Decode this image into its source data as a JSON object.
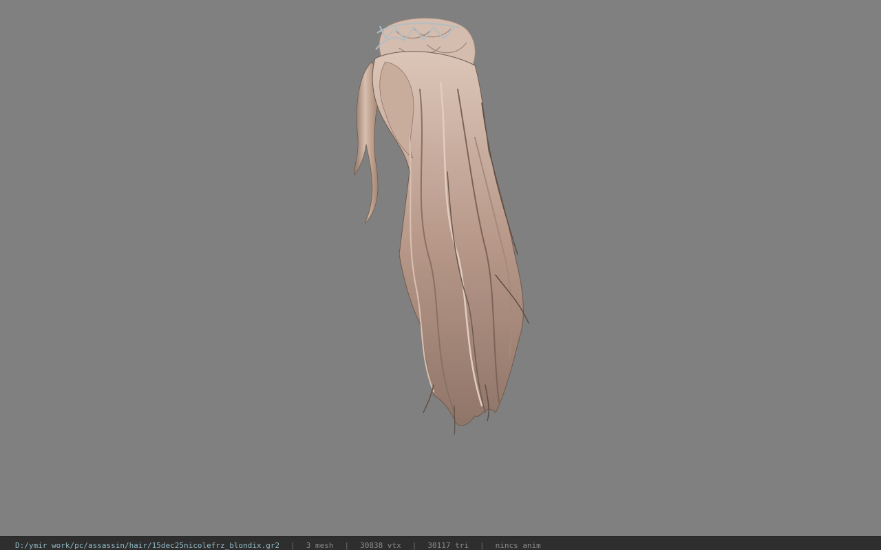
{
  "window": {
    "background": "#808080"
  },
  "viewport": {
    "model": {
      "description_icon": "hair-mesh-render",
      "colors": {
        "hair_light": "#d9bfae",
        "hair_mid": "#b79a88",
        "hair_dark": "#6d5a4e",
        "tiara": "#a9b4b8"
      }
    }
  },
  "statusbar": {
    "file_path": "D:/ymir work/pc/assassin/hair/15dec25nicolefrz_blondix.gr2",
    "separator": "|",
    "mesh_count": "3 mesh",
    "vertex_count": "30838 vtx",
    "triangle_count": "30117 tri",
    "anim_status": "nincs anim"
  }
}
